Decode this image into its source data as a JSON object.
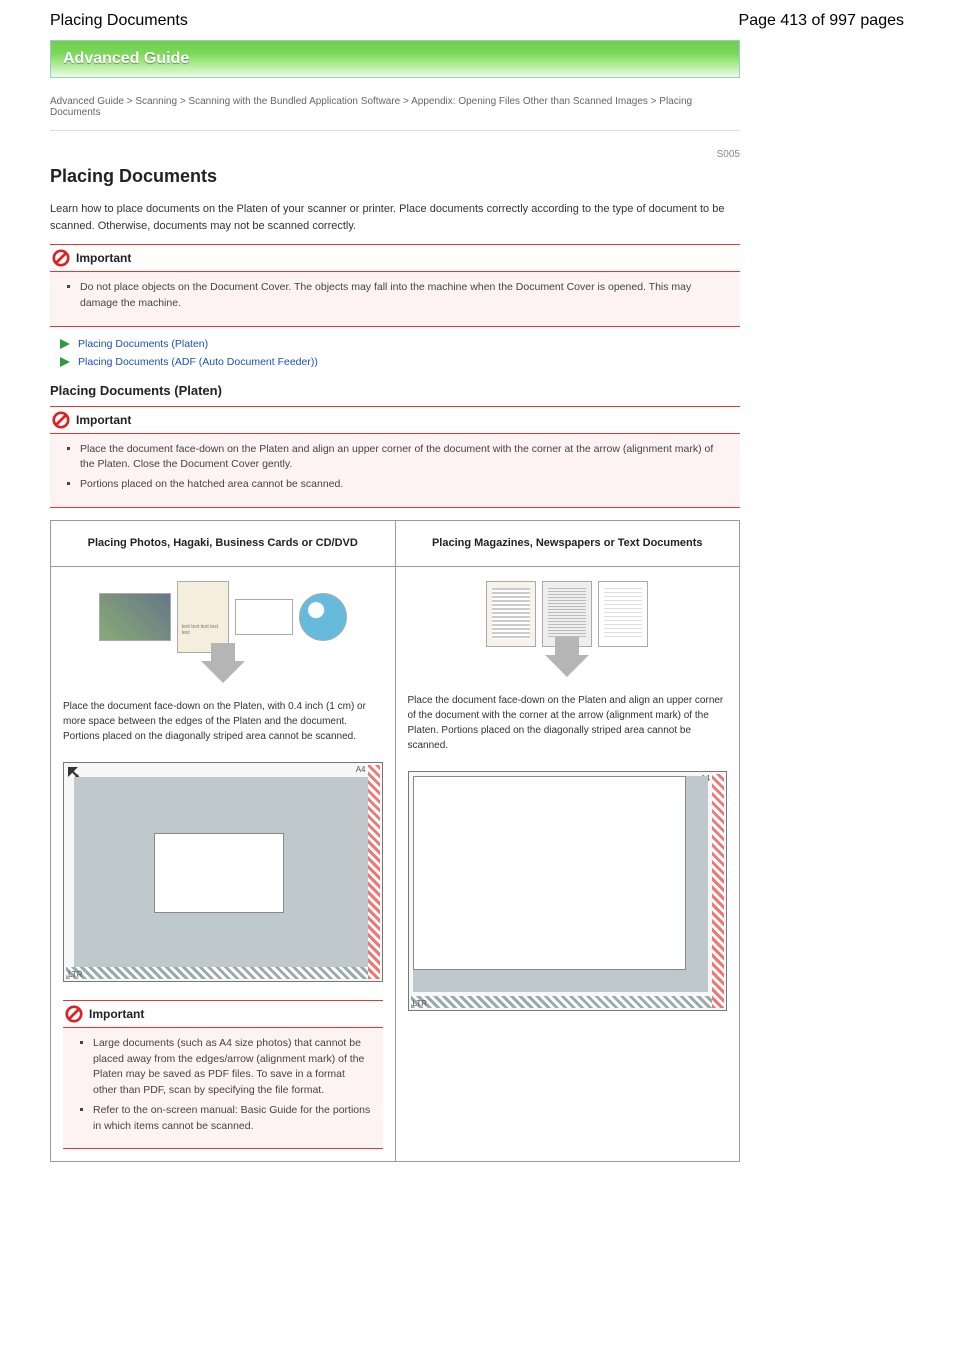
{
  "header": {
    "title": "Placing Documents",
    "page_counter": "Page 413 of 997 pages"
  },
  "banner": "Advanced Guide",
  "breadcrumb": "Advanced Guide > Scanning > Scanning with the Bundled Application Software > Appendix: Opening Files Other than Scanned Images > Placing Documents",
  "code": "S005",
  "h1": "Placing Documents",
  "intro": "Learn how to place documents on the Platen of your scanner or printer. Place documents correctly according to the type of document to be scanned. Otherwise, documents may not be scanned correctly.",
  "important_label": "Important",
  "important1_items": [
    "Do not place objects on the Document Cover. The objects may fall into the machine when the Document Cover is opened. This may damage the machine."
  ],
  "links": [
    "Placing Documents (Platen)",
    "Placing Documents (ADF (Auto Document Feeder))"
  ],
  "section_h": "Placing Documents (Platen)",
  "important2_items": [
    "Place the document face-down on the Platen and align an upper corner of the document with the corner at the arrow (alignment mark) of the Platen. Close the Document Cover gently.",
    "Portions placed on the hatched area cannot be scanned."
  ],
  "col1": {
    "head": "Placing Photos, Hagaki, Business Cards or CD/DVD",
    "instr": "Place the document face-down on the Platen, with 0.4 inch (1 cm) or more space between the edges of the Platen and the document. Portions placed on the diagonally striped area cannot be scanned.",
    "important": [
      "Large documents (such as A4 size photos) that cannot be placed away from the edges/arrow (alignment mark) of the Platen may be saved as PDF files. To save in a format other than PDF, scan by specifying the file format.",
      "Refer to the on-screen manual: Basic Guide for the portions in which items cannot be scanned."
    ]
  },
  "col2": {
    "head": "Placing Magazines, Newspapers or Text Documents",
    "instr": "Place the document face-down on the Platen and align an upper corner of the document with the corner at the arrow (alignment mark) of the Platen. Portions placed on the diagonally striped area cannot be scanned."
  },
  "labels": {
    "a4": "A4",
    "ltr": "LTR"
  }
}
